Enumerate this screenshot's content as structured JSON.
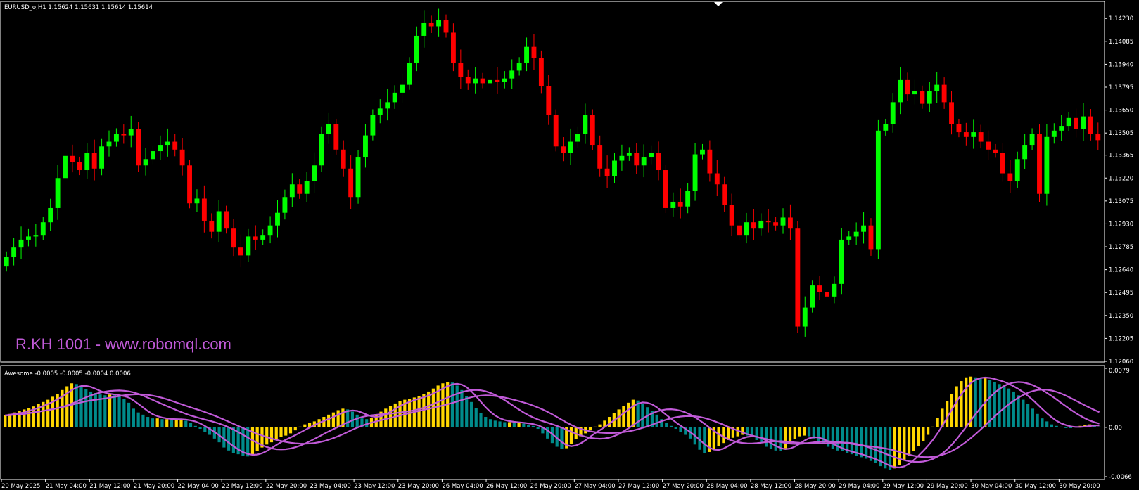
{
  "main_panel": {
    "header": "EURUSD_o,H1  1.15624 1.15631 1.15614 1.15614",
    "watermark": "R.KH 1001 - www.robomql.com"
  },
  "indicator_panel": {
    "header": "Awesome -0.0005 -0.0005 -0.0004 0.0006"
  },
  "colors": {
    "background": "#000000",
    "grid_frame": "#ffffff",
    "bull_candle": "#00ff00",
    "bear_candle": "#ff0000",
    "ao_up": "#ffd700",
    "ao_down": "#008b8b",
    "ma_lines": "#c15ad8",
    "watermark": "#c15ad8"
  },
  "chart_data": [
    {
      "type": "candlestick",
      "symbol": "EURUSD_o",
      "timeframe": "H1",
      "ylim": [
        1.1206,
        1.1432
      ],
      "y_ticks": [
        "1.14230",
        "1.14085",
        "1.13940",
        "1.13795",
        "1.13650",
        "1.13505",
        "1.13365",
        "1.13220",
        "1.13075",
        "1.12930",
        "1.12785",
        "1.12640",
        "1.12495",
        "1.12350",
        "1.12205",
        "1.12060"
      ],
      "x_ticks": [
        "20 May 2025",
        "21 May 04:00",
        "21 May 12:00",
        "21 May 20:00",
        "22 May 04:00",
        "22 May 12:00",
        "22 May 20:00",
        "23 May 04:00",
        "23 May 12:00",
        "23 May 20:00",
        "26 May 04:00",
        "26 May 12:00",
        "26 May 20:00",
        "27 May 04:00",
        "27 May 12:00",
        "27 May 20:00",
        "28 May 04:00",
        "28 May 12:00",
        "28 May 20:00",
        "29 May 04:00",
        "29 May 12:00",
        "29 May 20:00",
        "30 May 04:00",
        "30 May 12:00",
        "30 May 20:00"
      ],
      "closes": [
        1.1272,
        1.1278,
        1.1283,
        1.1285,
        1.1286,
        1.1294,
        1.1303,
        1.1322,
        1.1336,
        1.1332,
        1.1327,
        1.1338,
        1.1328,
        1.1342,
        1.1345,
        1.135,
        1.1349,
        1.1353,
        1.133,
        1.1334,
        1.1339,
        1.1343,
        1.1345,
        1.134,
        1.133,
        1.1306,
        1.1309,
        1.1295,
        1.1288,
        1.1301,
        1.129,
        1.1278,
        1.1273,
        1.1285,
        1.1283,
        1.1286,
        1.1292,
        1.13,
        1.131,
        1.1318,
        1.1312,
        1.132,
        1.133,
        1.135,
        1.1356,
        1.134,
        1.1328,
        1.131,
        1.1335,
        1.1349,
        1.1362,
        1.1366,
        1.137,
        1.1376,
        1.1381,
        1.1395,
        1.1412,
        1.142,
        1.1418,
        1.1422,
        1.1414,
        1.1395,
        1.1386,
        1.1382,
        1.1385,
        1.1382,
        1.1384,
        1.1383,
        1.1385,
        1.139,
        1.1395,
        1.1405,
        1.1398,
        1.138,
        1.1362,
        1.1342,
        1.1338,
        1.1345,
        1.135,
        1.1362,
        1.1343,
        1.1328,
        1.1323,
        1.1333,
        1.1336,
        1.1338,
        1.133,
        1.1335,
        1.1338,
        1.1327,
        1.1303,
        1.1307,
        1.1304,
        1.1314,
        1.1337,
        1.134,
        1.1325,
        1.1318,
        1.1305,
        1.1292,
        1.1286,
        1.1294,
        1.129,
        1.1295,
        1.1294,
        1.1292,
        1.1297,
        1.129,
        1.1228,
        1.124,
        1.1254,
        1.125,
        1.1247,
        1.1255,
        1.1283,
        1.1285,
        1.1288,
        1.1292,
        1.1277,
        1.1352,
        1.1356,
        1.137,
        1.1384,
        1.1375,
        1.1377,
        1.1369,
        1.1377,
        1.1381,
        1.137,
        1.1356,
        1.1351,
        1.1348,
        1.1351,
        1.1345,
        1.134,
        1.1338,
        1.1325,
        1.132,
        1.1334,
        1.1343,
        1.135,
        1.1312,
        1.1348,
        1.1352,
        1.1355,
        1.136,
        1.1353,
        1.1361,
        1.135,
        1.1346
      ],
      "watermark": "R.KH 1001 - www.robomql.com"
    },
    {
      "type": "bar",
      "indicator": "Awesome",
      "ylim": [
        -0.0066,
        0.0079
      ],
      "y_ticks": [
        "0.0079",
        "0.00",
        "-0.0066"
      ],
      "values": [
        0.0016,
        0.0018,
        0.002,
        0.0022,
        0.0024,
        0.0026,
        0.0028,
        0.0031,
        0.0034,
        0.0037,
        0.0041,
        0.0045,
        0.005,
        0.0055,
        0.0059,
        0.0058,
        0.0055,
        0.0051,
        0.0048,
        0.0046,
        0.0044,
        0.0043,
        0.0044,
        0.0043,
        0.0041,
        0.0038,
        0.0033,
        0.0025,
        0.002,
        0.0017,
        0.0014,
        0.0012,
        0.0012,
        0.0011,
        0.0011,
        0.001,
        0.0011,
        0.0011,
        0.0009,
        0.0006,
        0.0002,
        -0.0002,
        -0.0006,
        -0.001,
        -0.0015,
        -0.002,
        -0.0027,
        -0.0031,
        -0.0034,
        -0.0036,
        -0.0038,
        -0.0039,
        -0.0037,
        -0.0032,
        -0.0027,
        -0.0023,
        -0.002,
        -0.0016,
        -0.0013,
        -0.0011,
        -0.0008,
        -0.0004,
        0.0001,
        0.0004,
        0.0006,
        0.0008,
        0.0011,
        0.0014,
        0.0017,
        0.002,
        0.0023,
        0.0025,
        0.0024,
        0.0021,
        0.0017,
        0.0012,
        0.0011,
        0.0013,
        0.0017,
        0.0021,
        0.0025,
        0.0029,
        0.0032,
        0.0035,
        0.0037,
        0.0038,
        0.004,
        0.0042,
        0.0045,
        0.0048,
        0.0052,
        0.0056,
        0.0059,
        0.0061,
        0.006,
        0.0056,
        0.005,
        0.0042,
        0.0034,
        0.0026,
        0.0019,
        0.0014,
        0.0011,
        0.0009,
        0.0008,
        0.0007,
        0.0007,
        0.0006,
        0.0006,
        0.0005,
        0.0003,
        0.0002,
        -0.0002,
        -0.0008,
        -0.0015,
        -0.0021,
        -0.0026,
        -0.0029,
        -0.0028,
        -0.0022,
        -0.0016,
        -0.0012,
        -0.0008,
        -0.0004,
        0.0001,
        0.0004,
        0.0009,
        0.0014,
        0.0019,
        0.0024,
        0.0029,
        0.0033,
        0.0037,
        0.0036,
        0.0032,
        0.0027,
        0.0022,
        0.0017,
        0.0011,
        0.0006,
        0.0002,
        -0.0002,
        -0.0006,
        -0.001,
        -0.0015,
        -0.0023,
        -0.003,
        -0.0034,
        -0.0033,
        -0.0029,
        -0.0025,
        -0.0021,
        -0.0017,
        -0.0014,
        -0.0012,
        -0.001,
        -0.0011,
        -0.0013,
        -0.0017,
        -0.0021,
        -0.0026,
        -0.0029,
        -0.0031,
        -0.0032,
        -0.0028,
        -0.0022,
        -0.0016,
        -0.0012,
        -0.0011,
        -0.0012,
        -0.0015,
        -0.0018,
        -0.0022,
        -0.0026,
        -0.0029,
        -0.0031,
        -0.0032,
        -0.0034,
        -0.0036,
        -0.0038,
        -0.004,
        -0.0042,
        -0.0045,
        -0.0048,
        -0.0052,
        -0.0055,
        -0.0057,
        -0.0055,
        -0.005,
        -0.0044,
        -0.0038,
        -0.0032,
        -0.0025,
        -0.0018,
        -0.001,
        0.0001,
        0.0013,
        0.0025,
        0.0035,
        0.0045,
        0.0055,
        0.0062,
        0.0067,
        0.0068,
        0.0067,
        0.0066,
        0.0066,
        0.0064,
        0.0061,
        0.0058,
        0.0056,
        0.0052,
        0.0048,
        0.0043,
        0.0037,
        0.0031,
        0.0025,
        0.0018,
        0.0012,
        0.0008,
        0.0004,
        0.0002,
        0.0001,
        0.0,
        -0.0001,
        0.0001,
        0.0002,
        0.0003,
        0.0004,
        0.0003,
        0.0001
      ]
    }
  ]
}
